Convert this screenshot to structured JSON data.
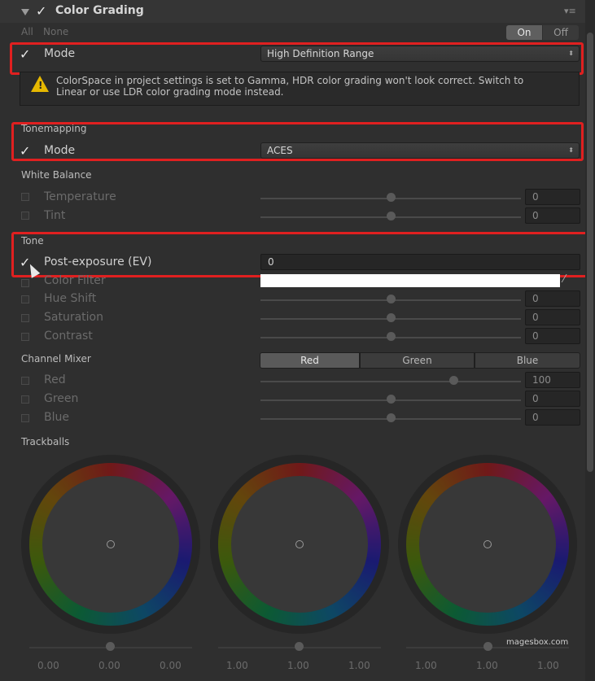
{
  "header": {
    "title": "Color Grading",
    "all_label": "All",
    "none_label": "None",
    "on_label": "On",
    "off_label": "Off"
  },
  "mode_row": {
    "label": "Mode",
    "value": "High Definition Range"
  },
  "warning": {
    "line1": "ColorSpace in project settings is set to Gamma, HDR color grading won't look correct. Switch to",
    "line2": "Linear or use LDR color grading mode instead."
  },
  "tonemapping": {
    "section": "Tonemapping",
    "mode_label": "Mode",
    "mode_value": "ACES"
  },
  "white_balance": {
    "section": "White Balance",
    "rows": [
      {
        "label": "Temperature",
        "value": "0",
        "slider": 0.5
      },
      {
        "label": "Tint",
        "value": "0",
        "slider": 0.5
      }
    ]
  },
  "tone": {
    "section": "Tone",
    "post_exposure_label": "Post-exposure (EV)",
    "post_exposure_value": "0",
    "color_filter_label": "Color Filter",
    "rows": [
      {
        "label": "Hue Shift",
        "value": "0",
        "slider": 0.5
      },
      {
        "label": "Saturation",
        "value": "0",
        "slider": 0.5
      },
      {
        "label": "Contrast",
        "value": "0",
        "slider": 0.5
      }
    ]
  },
  "channel_mixer": {
    "section": "Channel Mixer",
    "tabs": [
      "Red",
      "Green",
      "Blue"
    ],
    "active_tab": "Red",
    "rows": [
      {
        "label": "Red",
        "value": "100",
        "slider": 0.75
      },
      {
        "label": "Green",
        "value": "0",
        "slider": 0.5
      },
      {
        "label": "Blue",
        "value": "0",
        "slider": 0.5
      }
    ]
  },
  "trackballs": {
    "section": "Trackballs",
    "values": [
      [
        "0.00",
        "0.00",
        "0.00"
      ],
      [
        "1.00",
        "1.00",
        "1.00"
      ],
      [
        "1.00",
        "1.00",
        "1.00"
      ]
    ]
  },
  "watermark": "magesbox.com",
  "colors": {
    "highlight": "#e02020",
    "background": "#2f2f2f",
    "active_tab": "#5a5a5a"
  }
}
